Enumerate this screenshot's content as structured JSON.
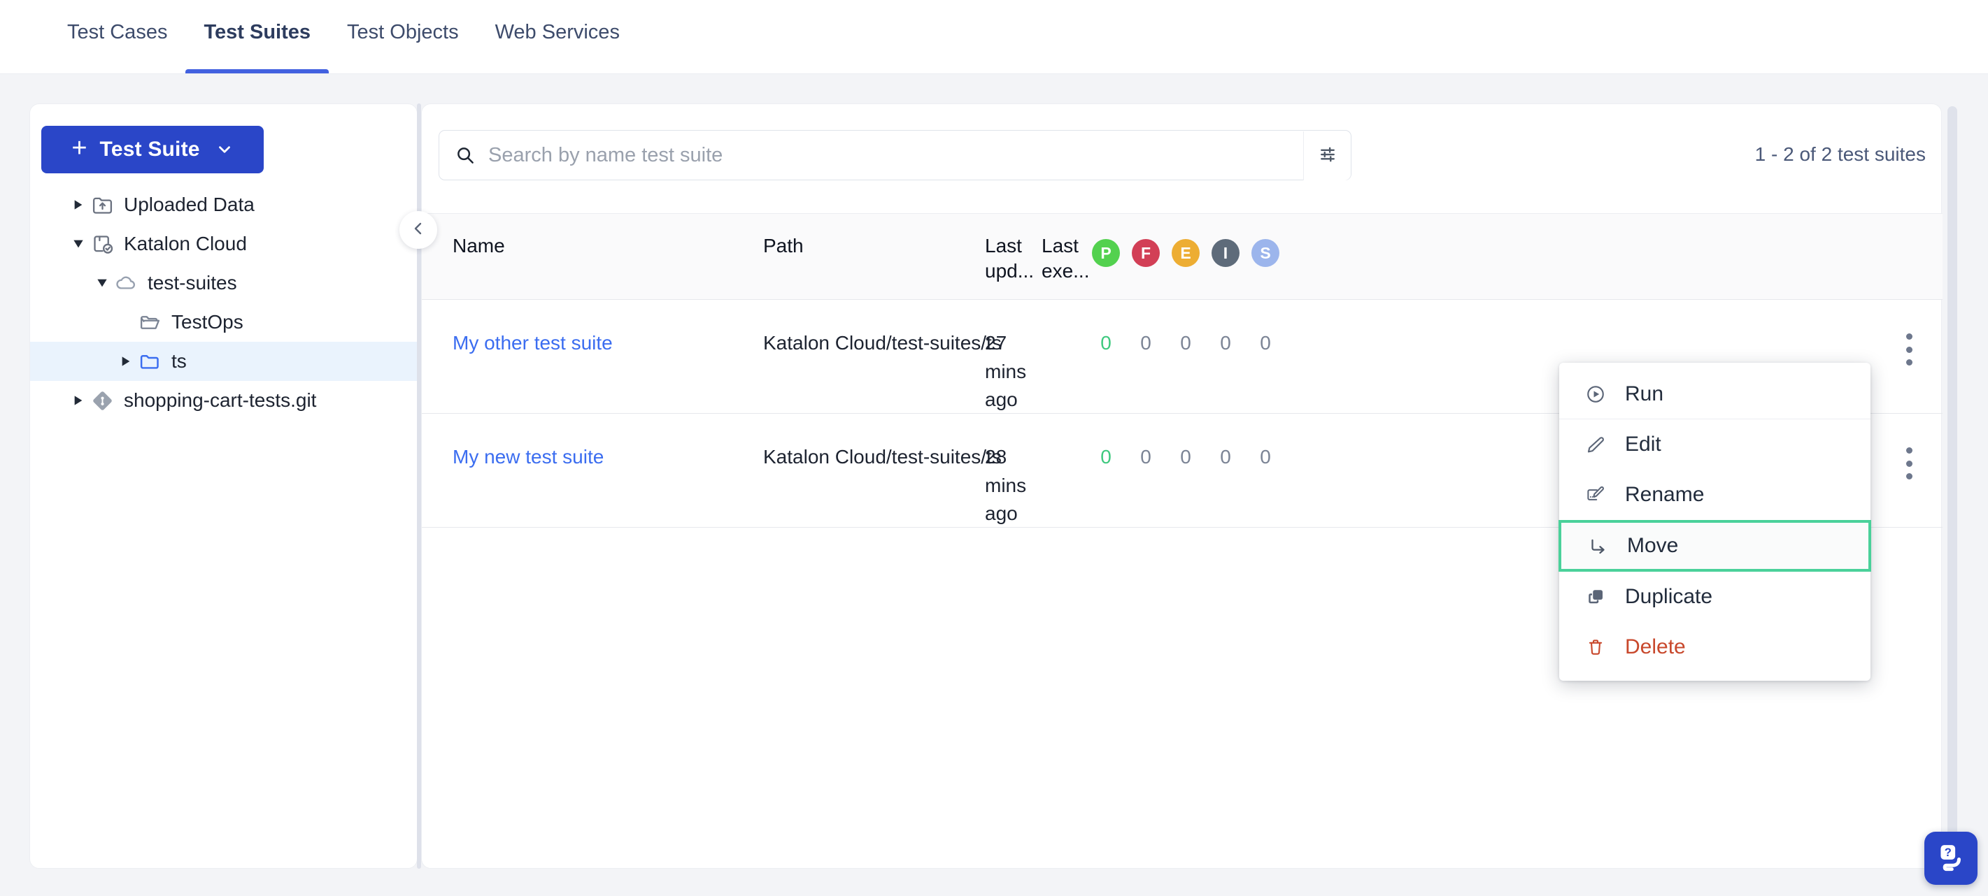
{
  "tabs": [
    {
      "label": "Test Cases",
      "active": false
    },
    {
      "label": "Test Suites",
      "active": true
    },
    {
      "label": "Test Objects",
      "active": false
    },
    {
      "label": "Web Services",
      "active": false
    }
  ],
  "sidebar": {
    "create_button": {
      "label": "Test Suite",
      "plus": "+",
      "chevron_icon": "chevron-down-icon"
    },
    "tree": [
      {
        "label": "Uploaded Data",
        "icon": "folder-upload-icon",
        "depth": 0,
        "caret": "collapsed",
        "selected": false
      },
      {
        "label": "Katalon Cloud",
        "icon": "cloud-project-icon",
        "depth": 0,
        "caret": "expanded",
        "selected": false
      },
      {
        "label": "test-suites",
        "icon": "cloud-icon",
        "depth": 1,
        "caret": "expanded",
        "selected": false
      },
      {
        "label": "TestOps",
        "icon": "folder-open-icon",
        "depth": 2,
        "caret": "none",
        "selected": false
      },
      {
        "label": "ts",
        "icon": "folder-blue-icon",
        "depth": 2,
        "caret": "collapsed",
        "selected": true
      },
      {
        "label": "shopping-cart-tests.git",
        "icon": "git-icon",
        "depth": 0,
        "caret": "collapsed",
        "selected": false
      }
    ]
  },
  "collapse_handle": {
    "icon": "chevron-left-icon"
  },
  "search": {
    "placeholder": "Search by name test suite",
    "value": "",
    "icon": "search-icon",
    "filter_icon": "filter-sliders-icon"
  },
  "result_count": "1 - 2 of 2 test suites",
  "table": {
    "columns": [
      {
        "key": "name",
        "label": "Name"
      },
      {
        "key": "path",
        "label": "Path"
      },
      {
        "key": "last_updated",
        "label": "Last upd..."
      },
      {
        "key": "last_executed",
        "label": "Last exe..."
      }
    ],
    "status_badges": [
      {
        "letter": "P",
        "name": "passed-badge",
        "color": "#53d14f"
      },
      {
        "letter": "F",
        "name": "failed-badge",
        "color": "#d23f56"
      },
      {
        "letter": "E",
        "name": "error-badge",
        "color": "#edad33"
      },
      {
        "letter": "I",
        "name": "incomplete-badge",
        "color": "#5e6b7a"
      },
      {
        "letter": "S",
        "name": "skipped-badge",
        "color": "#9cb5ec"
      }
    ],
    "rows": [
      {
        "name": "My other test suite",
        "path": "Katalon Cloud/test-suites/ts",
        "last_updated": "27 mins ago",
        "last_executed": "",
        "counts": [
          "0",
          "0",
          "0",
          "0",
          "0"
        ]
      },
      {
        "name": "My new test suite",
        "path": "Katalon Cloud/test-suites/ts",
        "last_updated": "28 mins ago",
        "last_executed": "",
        "counts": [
          "0",
          "0",
          "0",
          "0",
          "0"
        ]
      }
    ]
  },
  "context_menu": {
    "items": [
      {
        "label": "Run",
        "icon": "play-circle-icon",
        "highlighted": false,
        "danger": false,
        "separator": true
      },
      {
        "label": "Edit",
        "icon": "pencil-icon",
        "highlighted": false,
        "danger": false,
        "separator": false
      },
      {
        "label": "Rename",
        "icon": "rename-icon",
        "highlighted": false,
        "danger": false,
        "separator": false
      },
      {
        "label": "Move",
        "icon": "move-arrow-icon",
        "highlighted": true,
        "danger": false,
        "separator": false
      },
      {
        "label": "Duplicate",
        "icon": "duplicate-icon",
        "highlighted": false,
        "danger": false,
        "separator": false
      },
      {
        "label": "Delete",
        "icon": "trash-icon",
        "highlighted": false,
        "danger": true,
        "separator": false
      }
    ],
    "highlight_color": "#4ad19a"
  },
  "help_button": {
    "icon": "help-chat-icon",
    "color": "#2a46c8"
  },
  "colors": {
    "accent_blue": "#2a46c8",
    "link_blue": "#3b6df0",
    "tab_underline": "#4261e0",
    "page_bg": "#f3f4f7",
    "selected_tree": "#eaf3fd",
    "pass_green": "#3fc97f",
    "delete_red": "#c8482c"
  }
}
